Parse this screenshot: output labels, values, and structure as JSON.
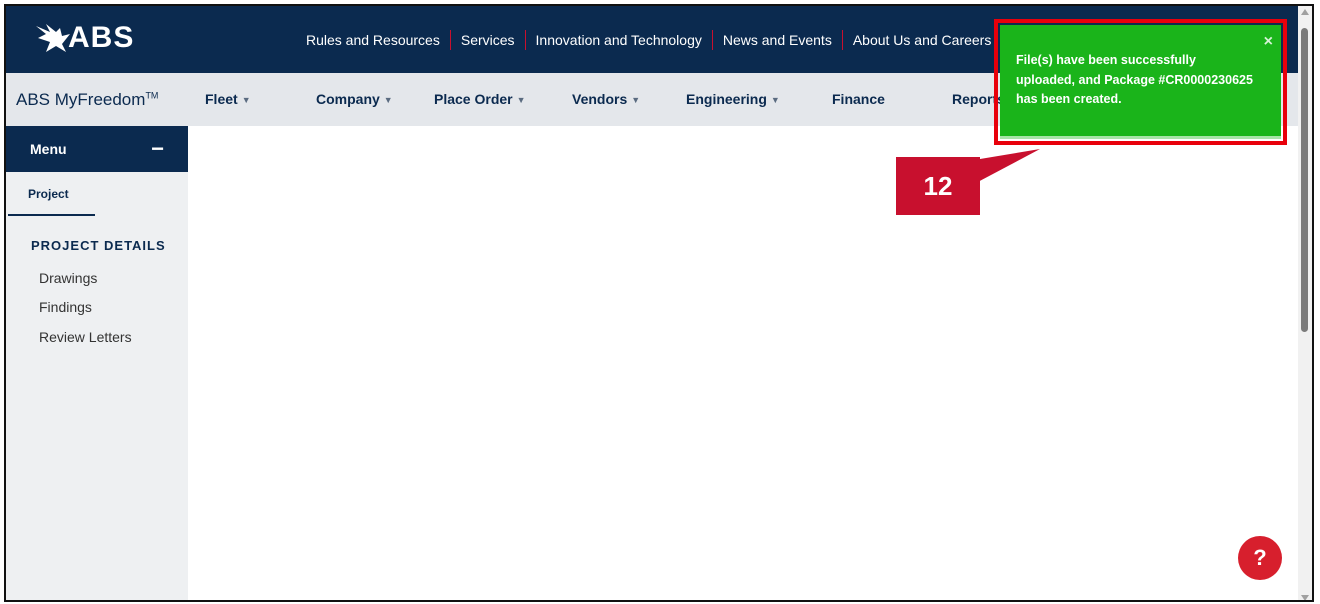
{
  "header": {
    "logo_text": "ABS",
    "nav": [
      "Rules and Resources",
      "Services",
      "Innovation and Technology",
      "News and Events",
      "About Us and Careers"
    ]
  },
  "subheader": {
    "brand": "ABS MyFreedom",
    "brand_mark": "TM",
    "nav": [
      {
        "label": "Fleet",
        "dropdown": true
      },
      {
        "label": "Company",
        "dropdown": true
      },
      {
        "label": "Place Order",
        "dropdown": true
      },
      {
        "label": "Vendors",
        "dropdown": true
      },
      {
        "label": "Engineering",
        "dropdown": true
      },
      {
        "label": "Finance",
        "dropdown": false
      },
      {
        "label": "Reports",
        "dropdown": false
      }
    ]
  },
  "sidebar": {
    "menu_title": "Menu",
    "collapse_symbol": "−",
    "tab": "Project",
    "section_title": "PROJECT DETAILS",
    "links": [
      "Drawings",
      "Findings",
      "Review Letters"
    ]
  },
  "toast": {
    "message": "File(s) have been successfully uploaded, and Package #CR0000230625 has been created.",
    "close": "×"
  },
  "callout": {
    "number": "12"
  },
  "help": {
    "label": "?"
  },
  "colors": {
    "navy": "#0b2a4f",
    "toast_green": "#1ab41a",
    "highlight_red": "#e8000b",
    "callout_red": "#c8102e",
    "help_red": "#d71f2d"
  }
}
